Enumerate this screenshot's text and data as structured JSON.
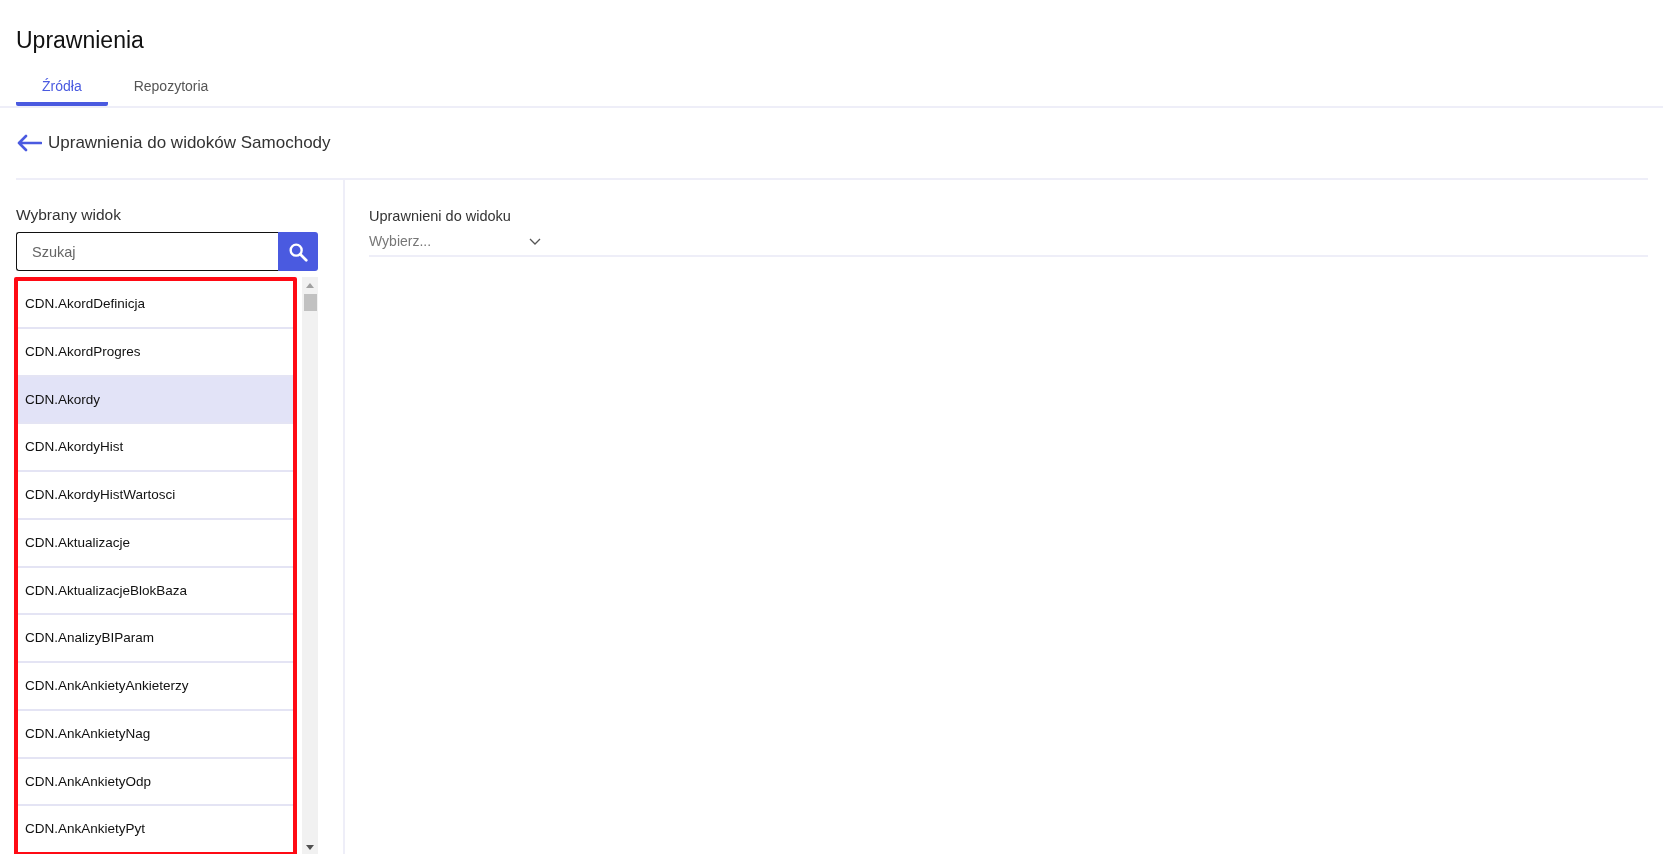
{
  "page": {
    "title": "Uprawnienia"
  },
  "tabs": [
    {
      "label": "Źródła",
      "selected": true
    },
    {
      "label": "Repozytoria",
      "selected": false
    }
  ],
  "header": {
    "title": "Uprawnienia do widoków Samochody"
  },
  "left_panel": {
    "label": "Wybrany widok",
    "search": {
      "placeholder": "Szukaj"
    },
    "items": [
      {
        "label": "CDN.AkordDefinicja",
        "selected": false
      },
      {
        "label": "CDN.AkordProgres",
        "selected": false
      },
      {
        "label": "CDN.Akordy",
        "selected": true
      },
      {
        "label": "CDN.AkordyHist",
        "selected": false
      },
      {
        "label": "CDN.AkordyHistWartosci",
        "selected": false
      },
      {
        "label": "CDN.Aktualizacje",
        "selected": false
      },
      {
        "label": "CDN.AktualizacjeBlokBaza",
        "selected": false
      },
      {
        "label": "CDN.AnalizyBIParam",
        "selected": false
      },
      {
        "label": "CDN.AnkAnkietyAnkieterzy",
        "selected": false
      },
      {
        "label": "CDN.AnkAnkietyNag",
        "selected": false
      },
      {
        "label": "CDN.AnkAnkietyOdp",
        "selected": false
      },
      {
        "label": "CDN.AnkAnkietyPyt",
        "selected": false
      }
    ]
  },
  "right_panel": {
    "label": "Uprawnieni do widoku",
    "select": {
      "placeholder": "Wybierz..."
    }
  }
}
